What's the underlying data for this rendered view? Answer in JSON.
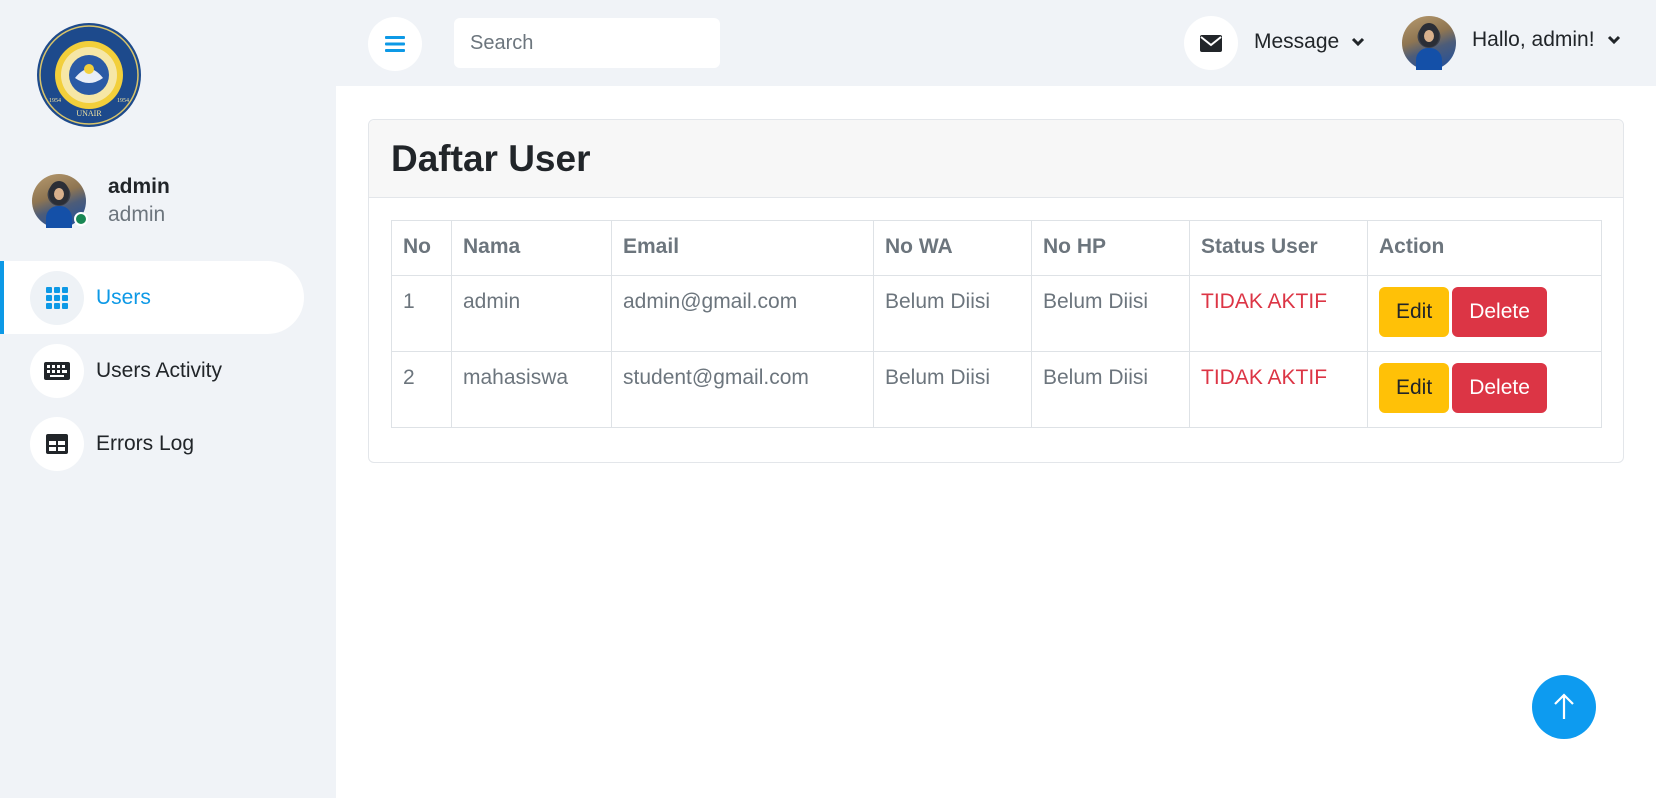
{
  "sidebar": {
    "logo_text": "UNIVERSITAS AIRLANGGA · UNAIR",
    "profile": {
      "name": "admin",
      "role": "admin"
    },
    "items": [
      {
        "label": "Users",
        "icon": "grid-icon",
        "active": true
      },
      {
        "label": "Users Activity",
        "icon": "keyboard-icon",
        "active": false
      },
      {
        "label": "Errors Log",
        "icon": "table-icon",
        "active": false
      }
    ]
  },
  "topbar": {
    "search_placeholder": "Search",
    "message_label": "Message",
    "greeting": "Hallo, admin!"
  },
  "main": {
    "title": "Daftar User",
    "table": {
      "headers": [
        "No",
        "Nama",
        "Email",
        "No WA",
        "No HP",
        "Status User",
        "Action"
      ],
      "rows": [
        {
          "no": "1",
          "nama": "admin",
          "email": "admin@gmail.com",
          "no_wa": "Belum Diisi",
          "no_hp": "Belum Diisi",
          "status": "TIDAK AKTIF"
        },
        {
          "no": "2",
          "nama": "mahasiswa",
          "email": "student@gmail.com",
          "no_wa": "Belum Diisi",
          "no_hp": "Belum Diisi",
          "status": "TIDAK AKTIF"
        }
      ],
      "edit_label": "Edit",
      "delete_label": "Delete"
    }
  },
  "colors": {
    "accent": "#0d99e6",
    "status_inactive": "#dc3545",
    "edit_button": "#ffc107",
    "delete_button": "#dc3545"
  }
}
